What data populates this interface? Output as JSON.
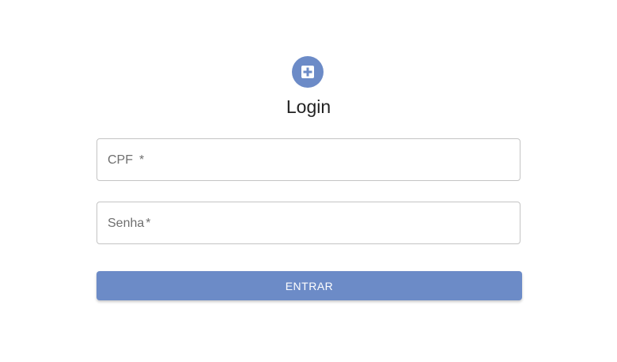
{
  "logo": {
    "icon": "medical-plus-icon",
    "color": "#6c8bc7"
  },
  "title": "Login",
  "form": {
    "cpf": {
      "label": "CPF",
      "required_mark": "*",
      "value": ""
    },
    "senha": {
      "label": "Senha",
      "required_mark": "*",
      "value": ""
    },
    "submit_label": "ENTRAR"
  },
  "colors": {
    "accent": "#6c8bc7",
    "border": "#c4c4c4",
    "label": "#6f6f6f"
  }
}
